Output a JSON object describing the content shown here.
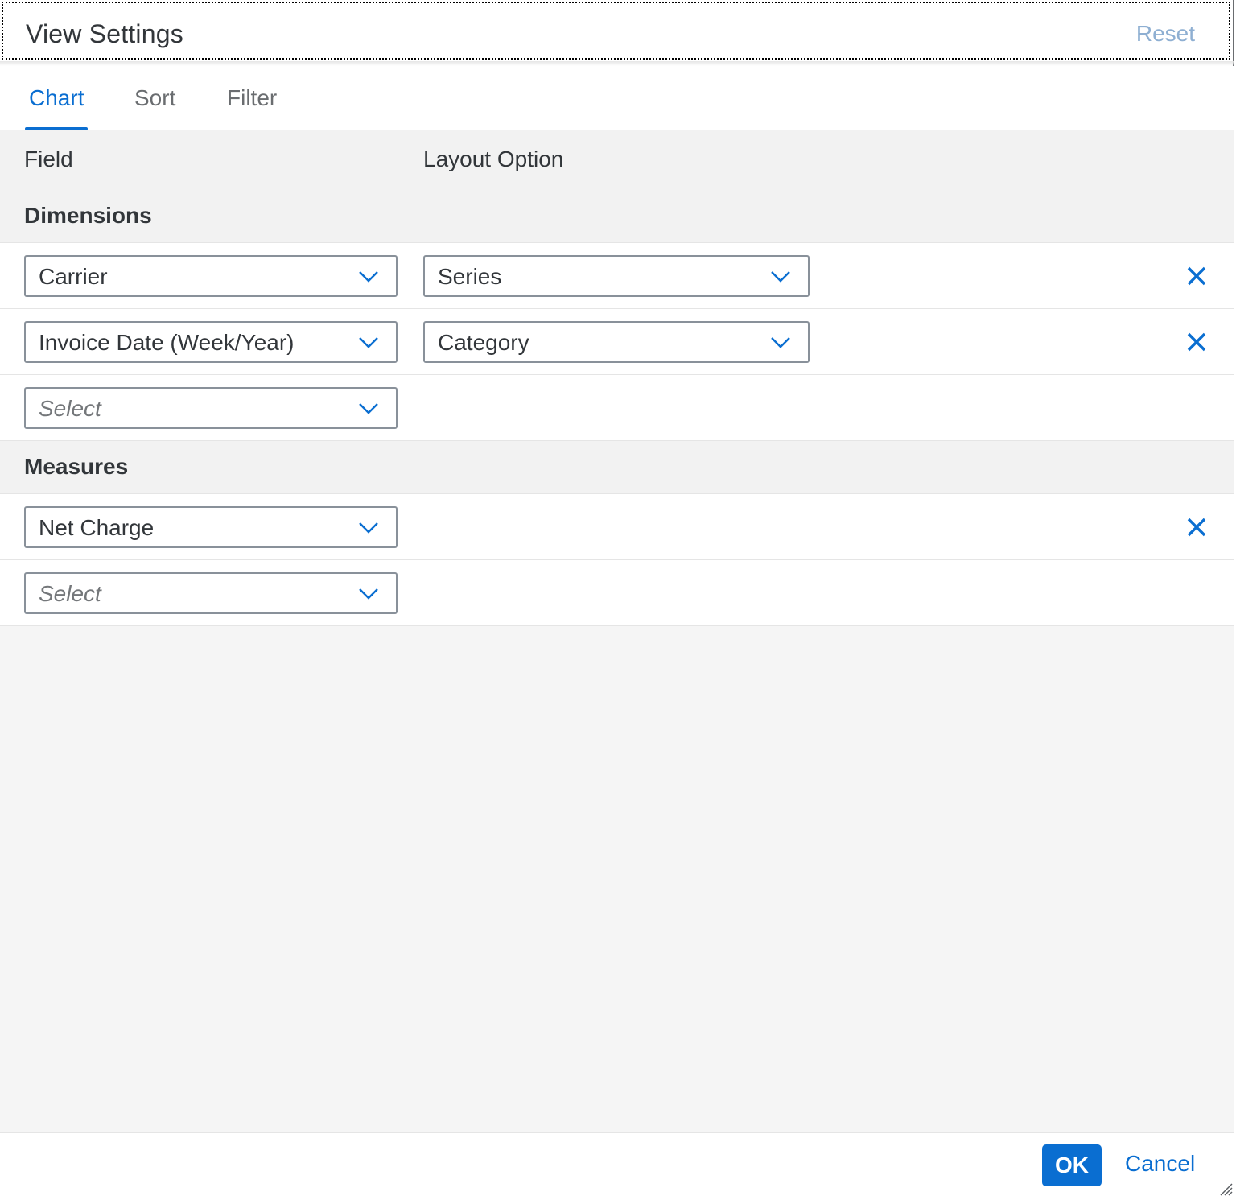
{
  "dialog": {
    "title": "View Settings",
    "reset_label": "Reset"
  },
  "tabs": [
    {
      "label": "Chart",
      "active": true
    },
    {
      "label": "Sort",
      "active": false
    },
    {
      "label": "Filter",
      "active": false
    }
  ],
  "columns": {
    "field": "Field",
    "layout_option": "Layout Option"
  },
  "dimensions": {
    "heading": "Dimensions",
    "rows": [
      {
        "field": "Carrier",
        "layout": "Series"
      },
      {
        "field": "Invoice Date (Week/Year)",
        "layout": "Category"
      }
    ],
    "placeholder": "Select"
  },
  "measures": {
    "heading": "Measures",
    "rows": [
      {
        "field": "Net Charge"
      }
    ],
    "placeholder": "Select"
  },
  "footer": {
    "ok_label": "OK",
    "cancel_label": "Cancel"
  },
  "colors": {
    "accent": "#0a6ed1",
    "reset_disabled": "#8eafd2",
    "group_background": "#f2f2f2",
    "empty_background": "#f5f5f5"
  },
  "icons": {
    "dropdown": "chevron-down-icon",
    "remove": "close-icon",
    "resize": "resize-grip-icon"
  }
}
